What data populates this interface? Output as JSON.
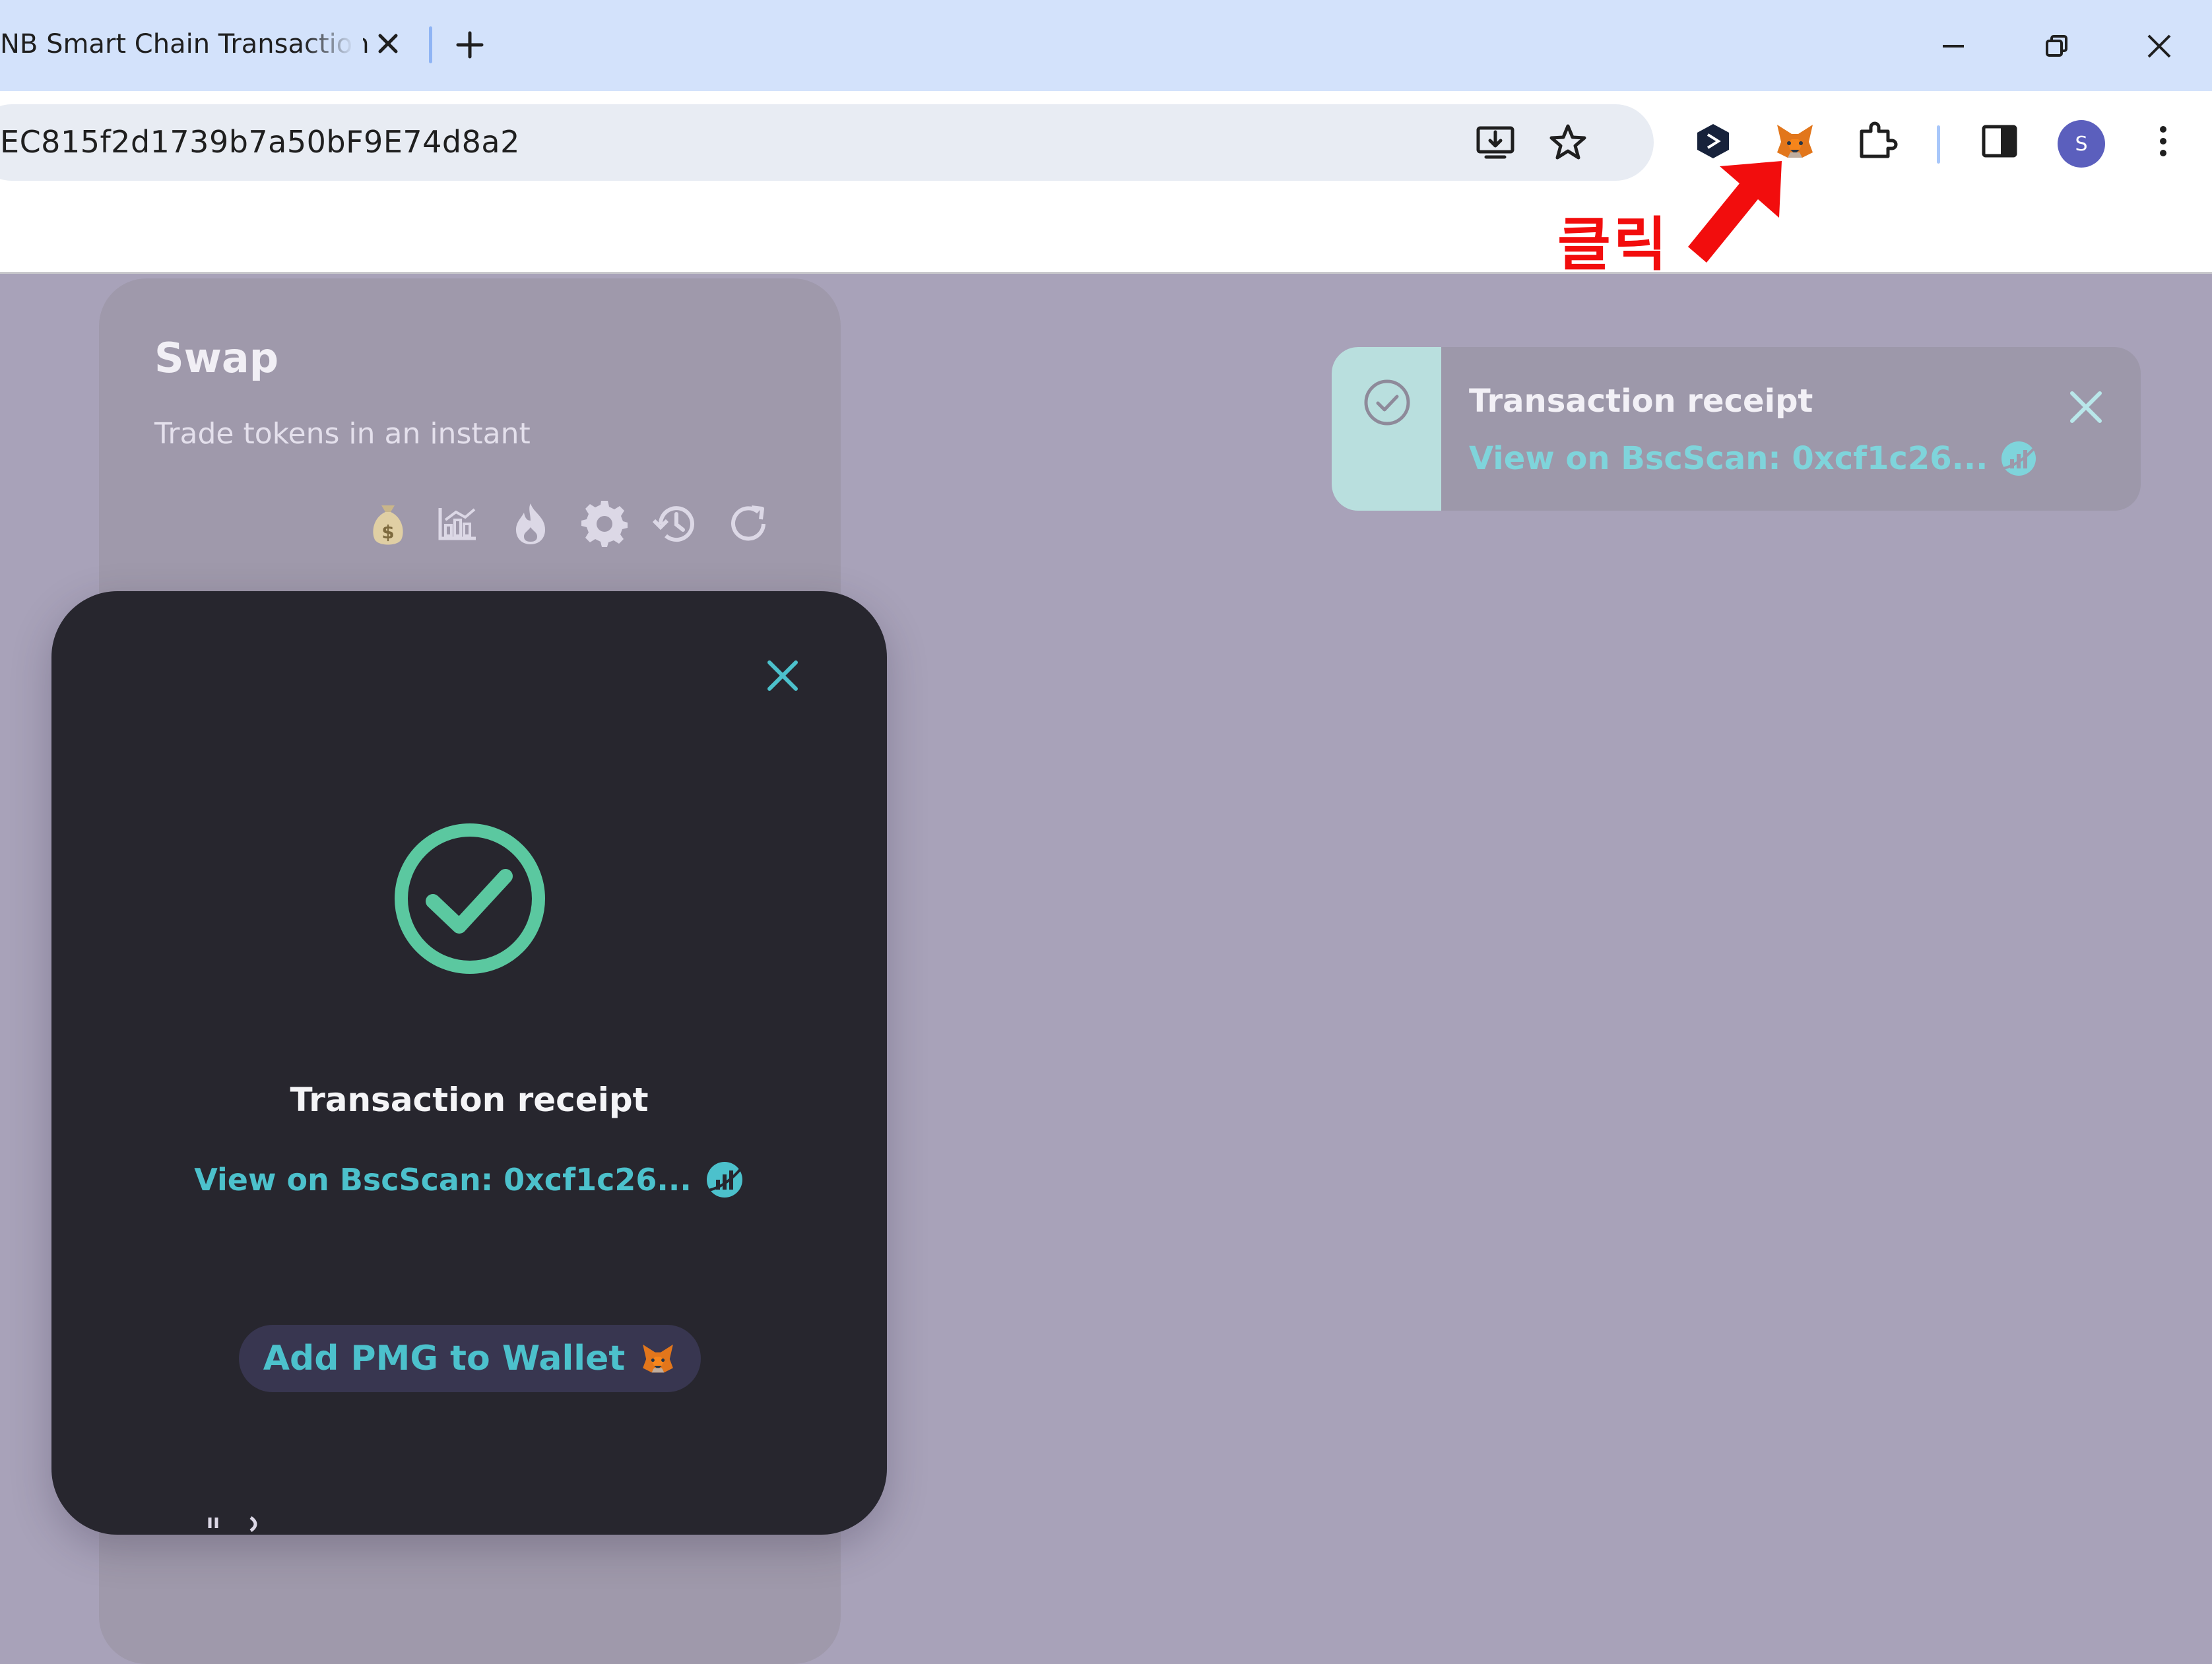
{
  "browser": {
    "tab_title": "NB Smart Chain Transaction",
    "url": "EC815f2d1739b7a50bF9E74d8a2",
    "profile_initial": "S"
  },
  "annotation": {
    "label": "클릭",
    "color": "#f20d0d"
  },
  "swap": {
    "title": "Swap",
    "subtitle": "Trade tokens in an instant",
    "tools": [
      "money-bag-icon",
      "chart-icon",
      "fire-icon",
      "settings-icon",
      "history-icon",
      "refresh-icon"
    ]
  },
  "toast": {
    "title": "Transaction receipt",
    "link": "View on BscScan: 0xcf1c26..."
  },
  "modal": {
    "title": "Transaction receipt",
    "link": "View on BscScan: 0xcf1c26...",
    "add_button": "Add PMG to Wallet"
  },
  "colors": {
    "accent": "#4cc1cc",
    "success": "#5bc8a0",
    "modal_bg": "#27262e",
    "overlay": "#a8a2b9"
  }
}
